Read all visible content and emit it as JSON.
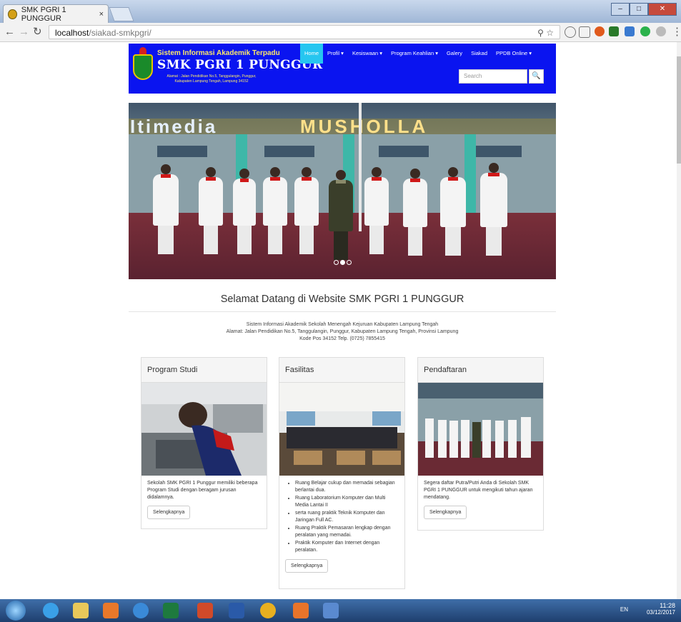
{
  "browser": {
    "tab_title": "SMK PGRI 1 PUNGGUR",
    "tab_close": "×",
    "url_host": "localhost",
    "url_path": "/siakad-smkpgri/",
    "info_icon": "ⓘ"
  },
  "site": {
    "brand_line1": "Sistem Informasi Akademik Terpadu",
    "brand_line2": "SMK PGRI 1 PUNGGUR",
    "brand_line3": "Alamat : Jalan Pendidikan No.5, Tanggulangin, Punggur, Kabupaten Lampung Tengah, Lampung 34152",
    "menu": [
      {
        "label": "Home"
      },
      {
        "label": "Profil ▾"
      },
      {
        "label": "Kesiswaan ▾"
      },
      {
        "label": "Program Keahlian ▾"
      },
      {
        "label": "Galery"
      },
      {
        "label": "Siakad"
      },
      {
        "label": "PPDB Online ▾"
      }
    ],
    "search_placeholder": "Search",
    "search_icon": "🔍"
  },
  "carousel": {
    "sign_left": "Itimedia",
    "sign_right": "MUSHOLLA"
  },
  "welcome": {
    "title": "Selamat Datang di Website SMK PGRI 1 PUNGGUR",
    "line1": "Sistem Informasi Akademik Sekolah Menengah Kejuruan Kabupaten Lampung Tengah",
    "line2": "Alamat: Jalan Pendidikan No.5, Tanggulangin, Punggur, Kabupaten Lampung Tengah, Provinsi Lampung",
    "line3": "Kode Pos 34152 Telp. (0725) 7855415"
  },
  "cards": [
    {
      "title": "Program Studi",
      "text": "Sekolah SMK PGRI 1 Punggur memiliki beberapa Program Studi dengan beragam jurusan didalamnya.",
      "button": "Selengkapnya"
    },
    {
      "title": "Fasilitas",
      "items": [
        "Ruang Belajar cukup dan memadai sebagian berlantai dua.",
        "Ruang Laboratorium Komputer dan Multi Media Lantai II",
        "serta ruang praktik Teknik Komputer dan Jaringan Full AC.",
        "Ruang Praktik Pemasaran lengkap dengan peralatan yang memadai.",
        "Praktik Komputer dan Internet dengan peralatan."
      ],
      "button": "Selengkapnya"
    },
    {
      "title": "Pendaftaran",
      "text": "Segera daftar Putra/Putri Anda di Sekolah SMK PGRI 1 PUNGGUR untuk mengikuti tahun ajaran mendatang.",
      "button": "Selengkapnya"
    }
  ],
  "taskbar": {
    "lang": "EN",
    "time": "11:28",
    "date": "03/12/2017"
  }
}
